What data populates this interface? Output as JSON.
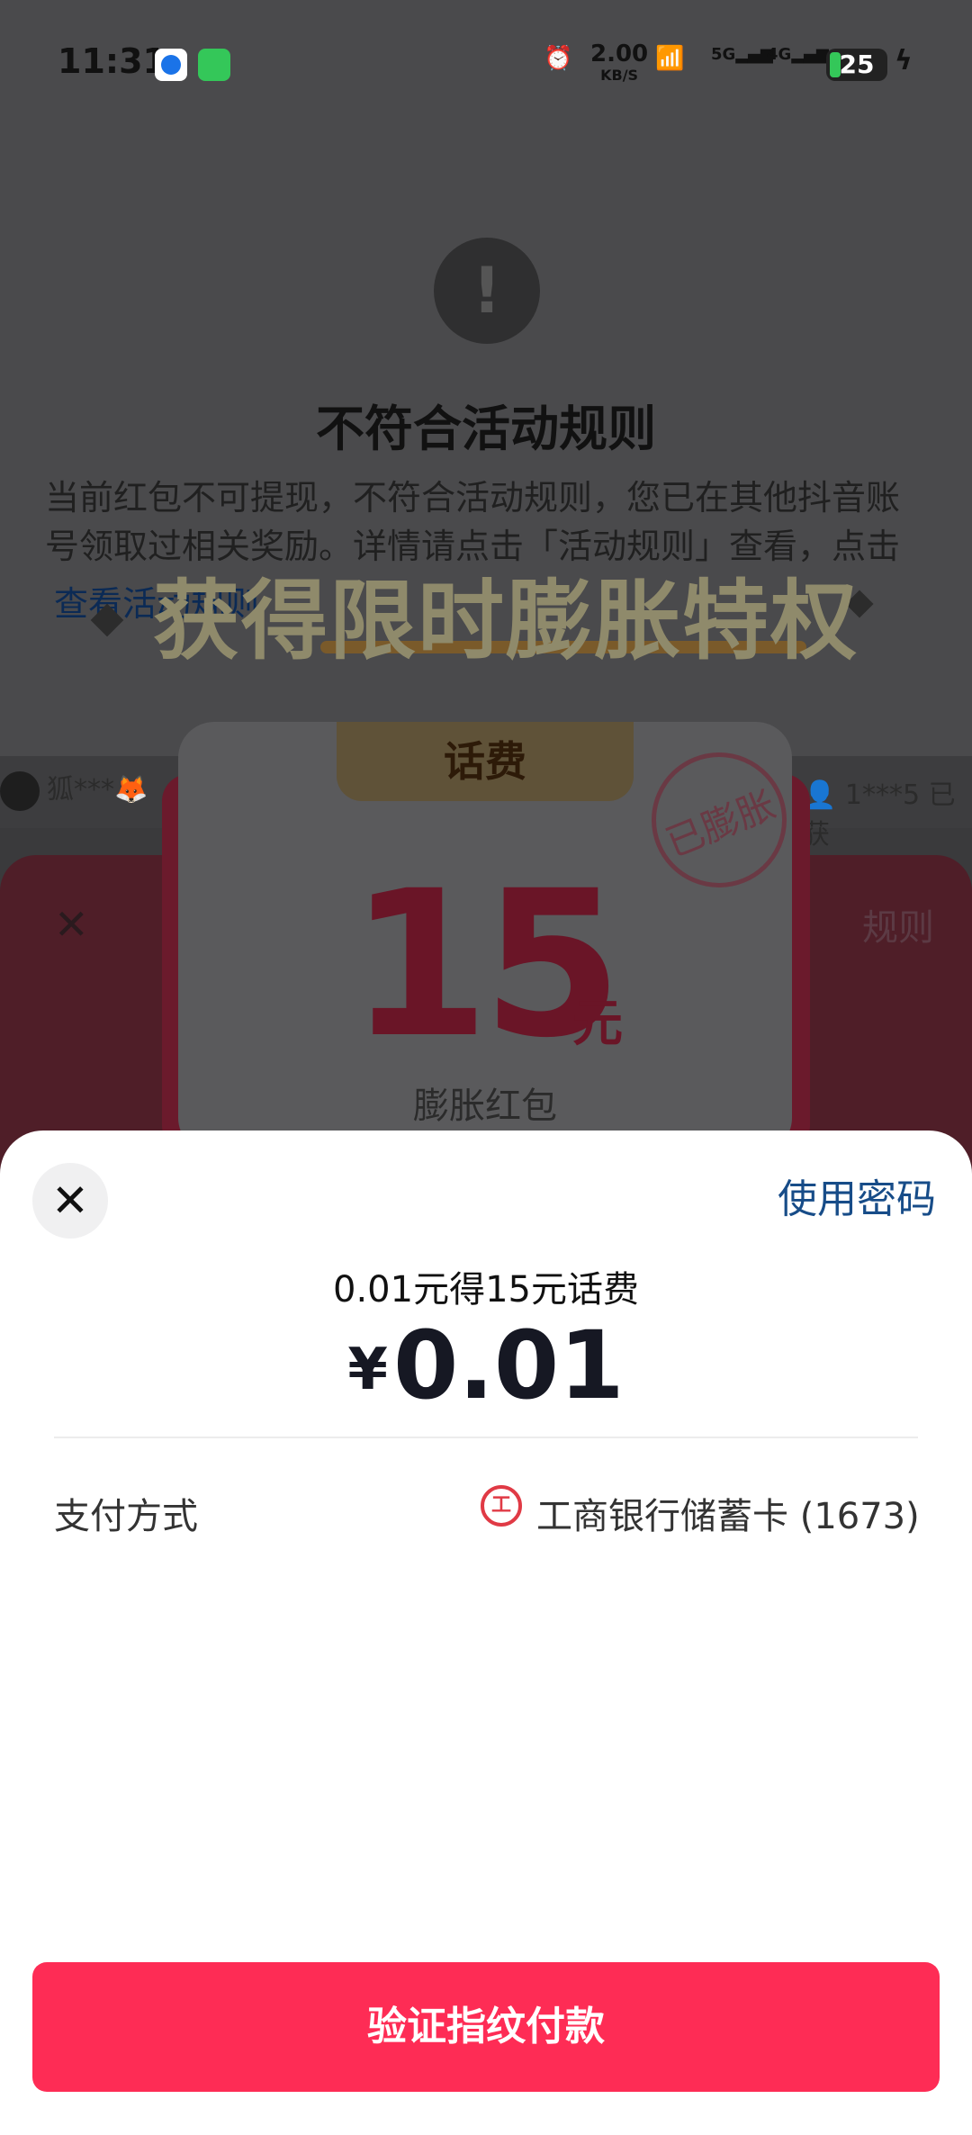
{
  "status_bar": {
    "time": "11:31",
    "net_speed": "2.00",
    "net_unit": "KB/S",
    "sim1": "5G",
    "sim2": "4G",
    "battery": "25"
  },
  "background": {
    "dialog_title": "不符合活动规则",
    "dialog_text": "当前红包不可提现，不符合活动规则，您已在其他抖音账号领取过相关奖励。详情请点击「活动规则」查看，点击",
    "dialog_link": "查看活动规则",
    "promo_title": "获得限时膨胀特权",
    "ticker_left": "狐***🦊",
    "ticker_right": "1***5 已获",
    "rules_label": "规则",
    "coupon": {
      "tab_label": "话费",
      "stamp": "已膨胀",
      "amount": "15",
      "unit": "元",
      "subtitle": "膨胀红包"
    }
  },
  "payment_sheet": {
    "use_password": "使用密码",
    "description": "0.01元得15元话费",
    "currency": "¥",
    "price": "0.01",
    "payment_method_label": "支付方式",
    "bank_icon_glyph": "ICBC",
    "payment_method_value": "工商银行储蓄卡 (1673)",
    "pay_button": "验证指纹付款"
  },
  "colors": {
    "accent": "#fe2c55",
    "link": "#174c88"
  }
}
